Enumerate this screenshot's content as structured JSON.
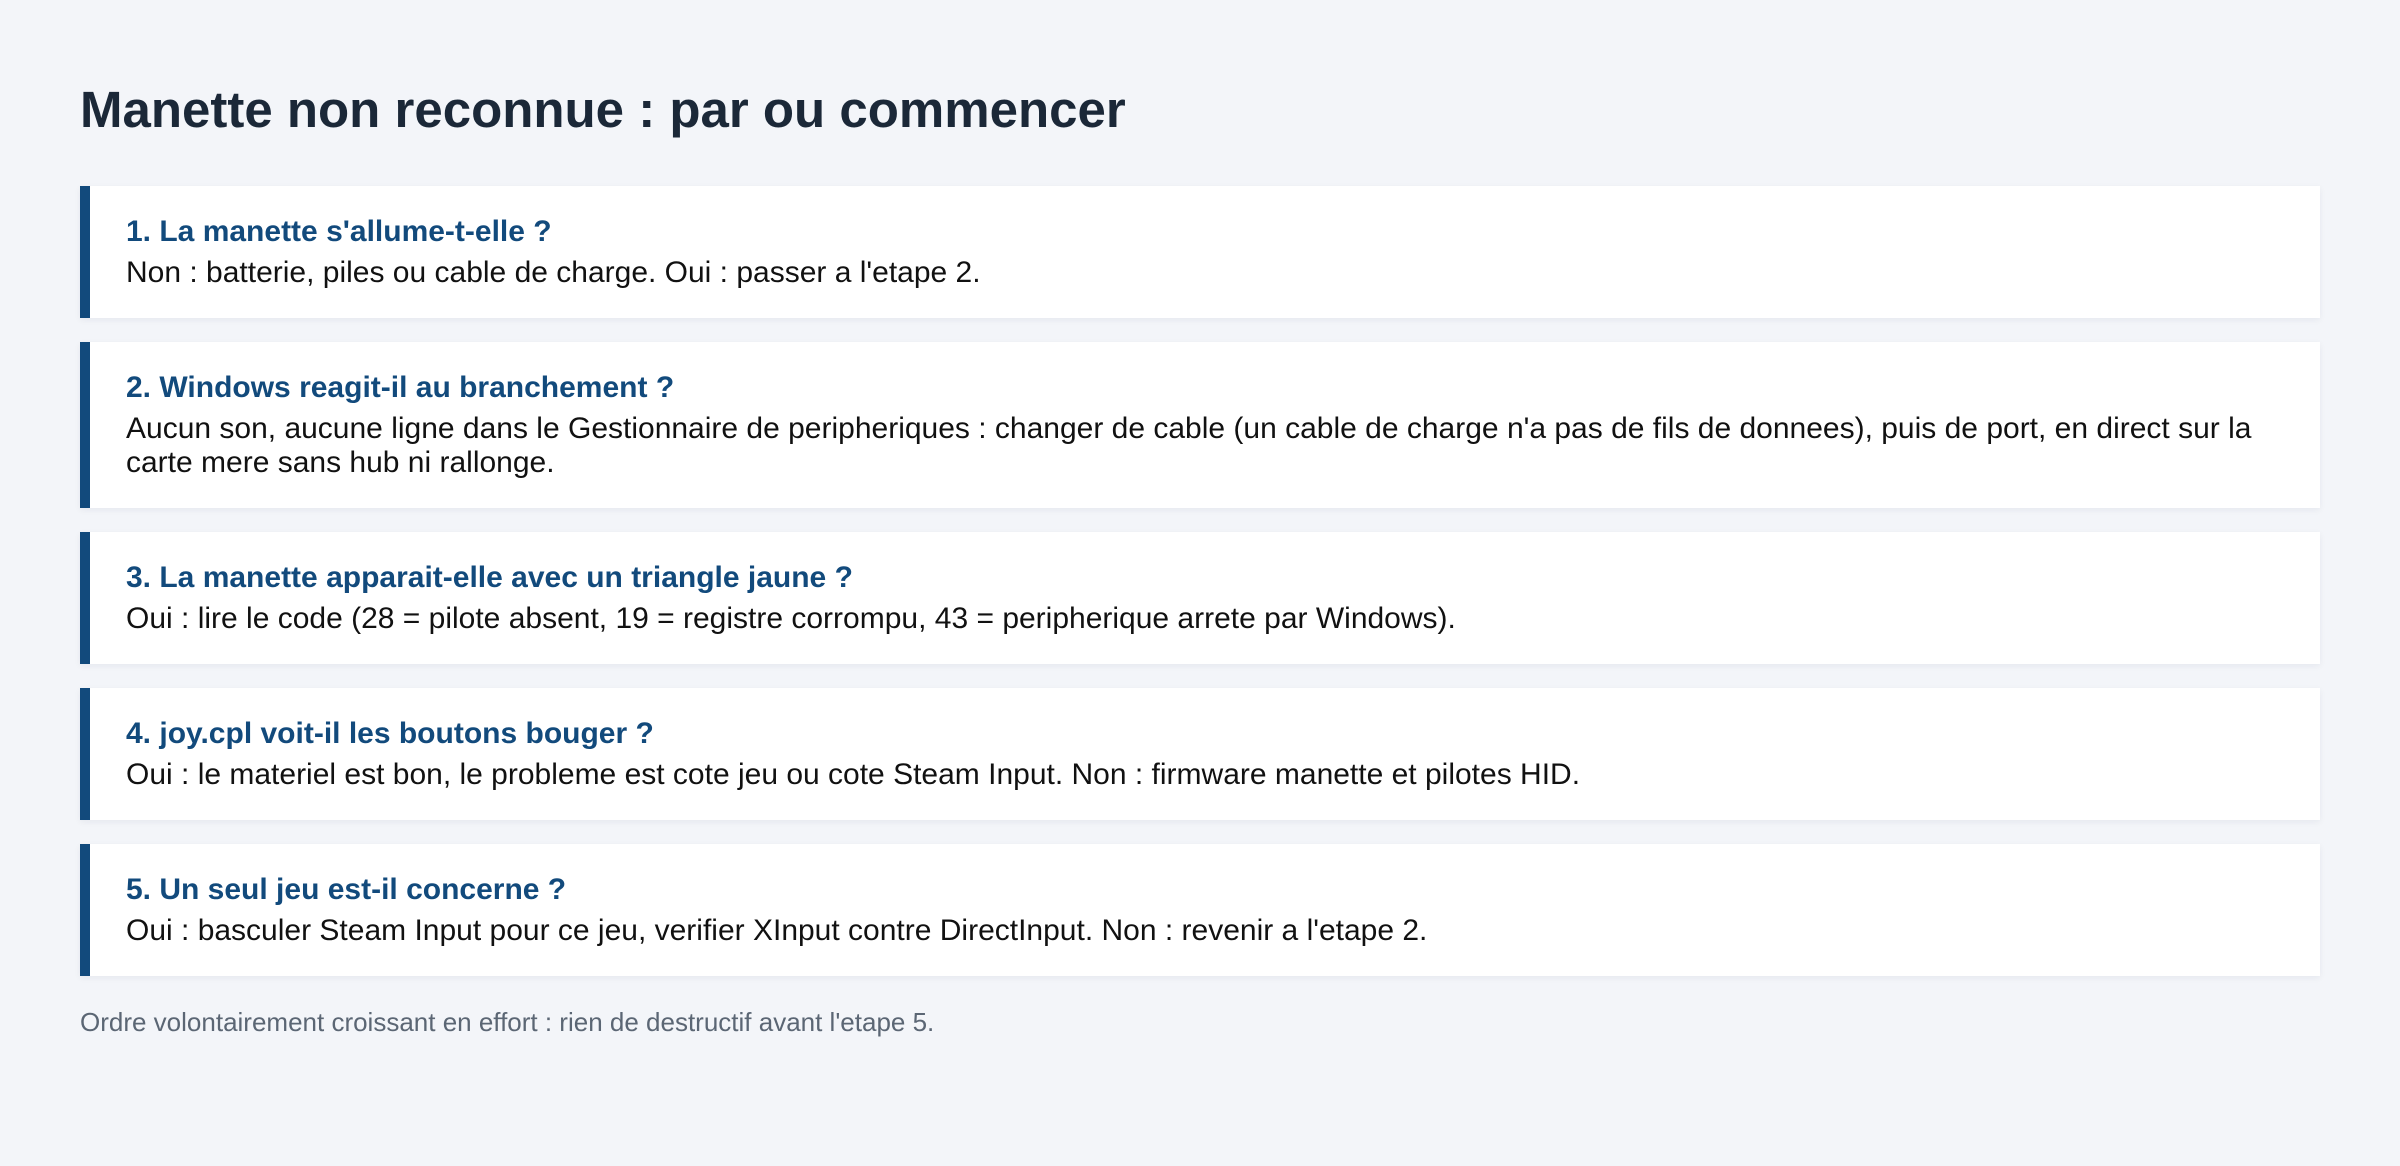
{
  "page": {
    "title": "Manette non reconnue : par ou commencer",
    "footnote": "Ordre volontairement croissant en effort : rien de destructif avant l'etape 5."
  },
  "steps": [
    {
      "heading": "1. La manette s'allume-t-elle ?",
      "body": "Non : batterie, piles ou cable de charge. Oui : passer a l'etape 2."
    },
    {
      "heading": "2. Windows reagit-il au branchement ?",
      "body": "Aucun son, aucune ligne dans le Gestionnaire de peripheriques : changer de cable (un cable de charge n'a pas de fils de donnees), puis de port, en direct sur la carte mere sans hub ni rallonge."
    },
    {
      "heading": "3. La manette apparait-elle avec un triangle jaune ?",
      "body": "Oui : lire le code (28 = pilote absent, 19 = registre corrompu, 43 = peripherique arrete par Windows)."
    },
    {
      "heading": "4. joy.cpl voit-il les boutons bouger ?",
      "body": "Oui : le materiel est bon, le probleme est cote jeu ou cote Steam Input. Non : firmware manette et pilotes HID."
    },
    {
      "heading": "5. Un seul jeu est-il concerne ?",
      "body": "Oui : basculer Steam Input pour ce jeu, verifier XInput contre DirectInput. Non : revenir a l'etape 2."
    }
  ],
  "colors": {
    "accent": "#124a7c",
    "background": "#f3f5f9",
    "card": "#ffffff",
    "title": "#1b2838",
    "footnote": "#5b6674"
  }
}
